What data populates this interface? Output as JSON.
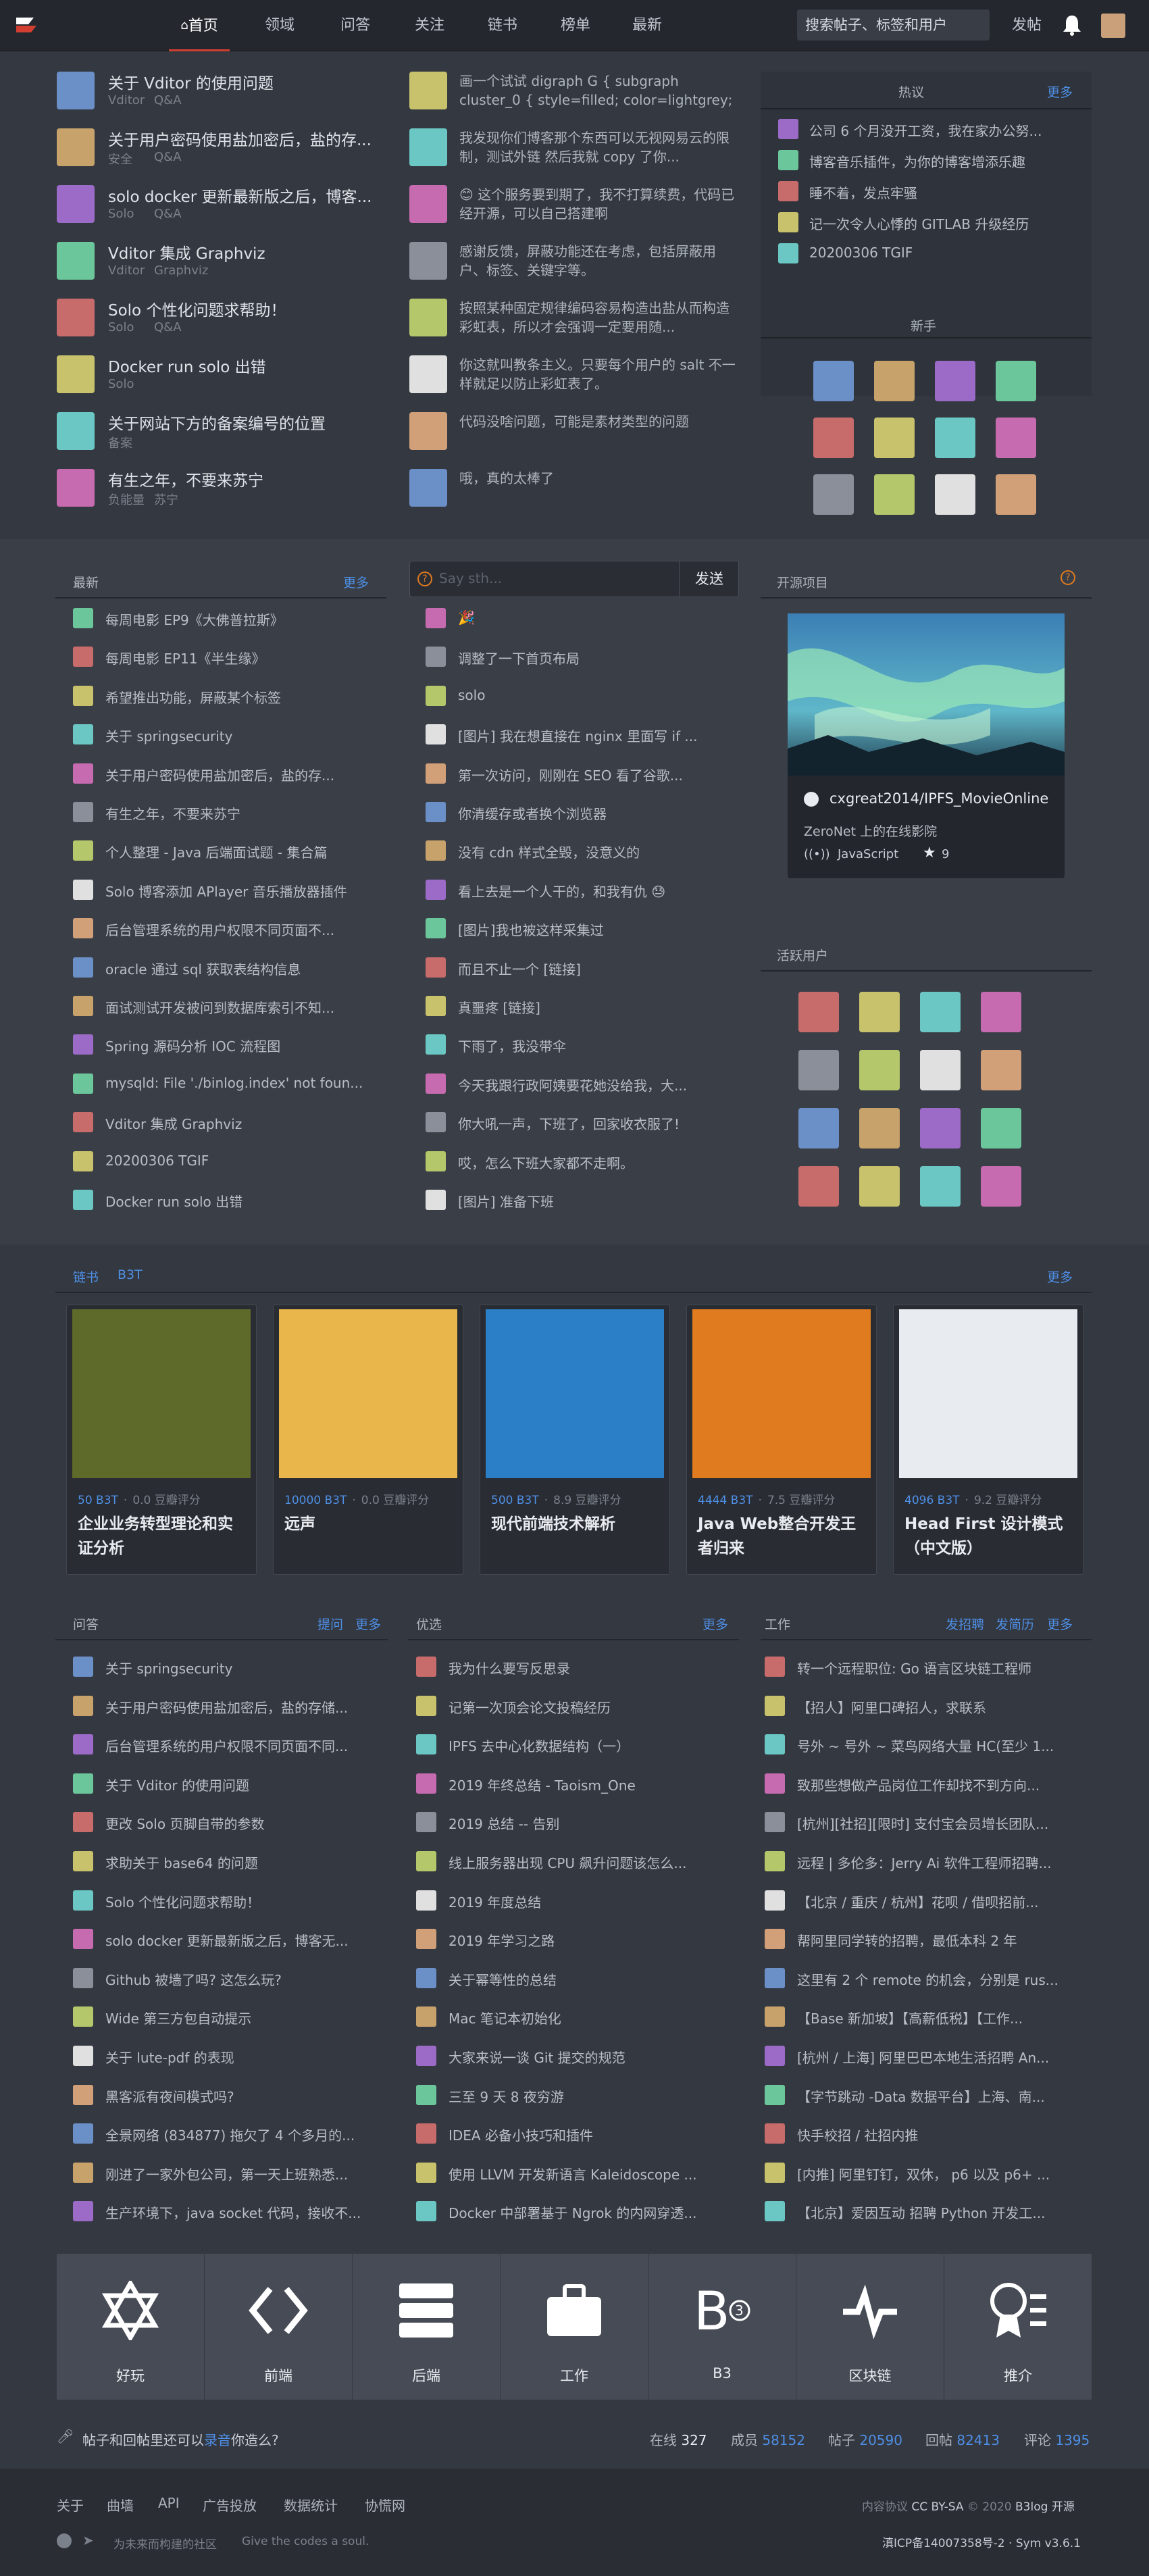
{
  "colors": {
    "accent": "#d23f31",
    "link": "#4e8fe5",
    "bg": "#343841",
    "nav_bg": "#24272e"
  },
  "nav": {
    "items": [
      "首页",
      "领域",
      "问答",
      "关注",
      "链书",
      "榜单",
      "最新"
    ],
    "search_placeholder": "搜索帖子、标签和用户",
    "post": "发帖"
  },
  "top": {
    "left": [
      {
        "title": "关于 Vditor 的使用问题",
        "tags": [
          "Vditor",
          "Q&A"
        ]
      },
      {
        "title": "关于用户密码使用盐加密后，盐的存...",
        "tags": [
          "安全",
          "Q&A"
        ]
      },
      {
        "title": "solo docker 更新最新版之后，博客...",
        "tags": [
          "Solo",
          "Q&A"
        ]
      },
      {
        "title": "Vditor 集成 Graphviz",
        "tags": [
          "Vditor",
          "Graphviz"
        ]
      },
      {
        "title": "Solo 个性化问题求帮助！",
        "tags": [
          "Solo",
          "Q&A"
        ]
      },
      {
        "title": "Docker run solo 出错",
        "tags": [
          "Solo"
        ]
      },
      {
        "title": "关于网站下方的备案编号的位置",
        "tags": [
          "备案"
        ]
      },
      {
        "title": "有生之年，不要来苏宁",
        "tags": [
          "负能量",
          "苏宁"
        ]
      }
    ],
    "mid": [
      "画一个试试 digraph G { subgraph cluster_0 { style=filled; color=lightgrey; node [...",
      "我发现你们博客那个东西可以无视网易云的限制，测试外链 然后我就 copy 了你...",
      "😊 这个服务要到期了，我不打算续费，代码已经开源，可以自己搭建啊",
      "感谢反馈，屏蔽功能还在考虑，包括屏蔽用户、标签、关键字等。",
      "按照某种固定规律编码容易构造出盐从而构造彩虹表，所以才会强调一定要用随...",
      "你这就叫教条主义。只要每个用户的 salt 不一样就足以防止彩虹表了。",
      "代码没啥问题，可能是素材类型的问题",
      "哦，真的太棒了"
    ],
    "hot": {
      "title": "热议",
      "more": "更多",
      "items": [
        "公司 6 个月没开工资，我在家办公努...",
        "博客音乐插件，为你的博客增添乐趣",
        "睡不着，发点牢骚",
        "记一次令人心悸的 GITLAB 升级经历",
        "20200306 TGIF"
      ]
    },
    "newbie": {
      "title": "新手"
    }
  },
  "latest": {
    "title": "最新",
    "more": "更多",
    "items": [
      "每周电影 EP9《大佛普拉斯》",
      "每周电影 EP11《半生缘》",
      "希望推出功能，屏蔽某个标签",
      "关于 springsecurity",
      "关于用户密码使用盐加密后，盐的存...",
      "有生之年，不要来苏宁",
      "个人整理 - Java 后端面试题 - 集合篇",
      "Solo 博客添加 APlayer 音乐播放器插件",
      "后台管理系统的用户权限不同页面不...",
      "oracle 通过 sql 获取表结构信息",
      "面试测试开发被问到数据库索引不知...",
      "Spring 源码分析 IOC 流程图",
      "mysqld: File './binlog.index' not foun...",
      "Vditor 集成 Graphviz",
      "20200306 TGIF",
      "Docker run solo 出错"
    ]
  },
  "chat": {
    "placeholder": "Say sth...",
    "send": "发送",
    "items": [
      "🎉",
      "调整了一下首页布局",
      "solo",
      "[图片] 我在想直接在 nginx 里面写 if ...",
      "第一次访问，刚刚在 SEO 看了谷歌...",
      "你清缓存或者换个浏览器",
      "没有 cdn 样式全毁，没意义的",
      "看上去是一个人干的，和我有仇 😓",
      "[图片]我也被这样采集过",
      "而且不止一个 [链接]",
      "真噩疼 [链接]",
      "下雨了，我没带伞",
      "今天我跟行政阿姨要花她没给我，大...",
      "你大吼一声，下班了，回家收衣服了!",
      "哎，怎么下班大家都不走啊。",
      "[图片] 准备下班"
    ]
  },
  "project": {
    "title": "开源项目",
    "repo": "cxgreat2014/IPFS_MovieOnline",
    "desc": "ZeroNet 上的在线影院",
    "lang": "JavaScript",
    "stars": "9"
  },
  "active": {
    "title": "活跃用户"
  },
  "books": {
    "tabs": [
      "链书",
      "B3T"
    ],
    "more": "更多",
    "items": [
      {
        "b3t": "50 B3T",
        "score": "0.0 豆瓣评分",
        "title": "企业业务转型理论和实证分析"
      },
      {
        "b3t": "10000 B3T",
        "score": "0.0 豆瓣评分",
        "title": "远声"
      },
      {
        "b3t": "500 B3T",
        "score": "8.9 豆瓣评分",
        "title": "现代前端技术解析"
      },
      {
        "b3t": "4444 B3T",
        "score": "7.5 豆瓣评分",
        "title": "Java Web整合开发王者归来"
      },
      {
        "b3t": "4096 B3T",
        "score": "9.2 豆瓣评分",
        "title": "Head First 设计模式（中文版）"
      }
    ]
  },
  "qa": {
    "title": "问答",
    "ask": "提问",
    "more": "更多",
    "items": [
      "关于 springsecurity",
      "关于用户密码使用盐加密后，盐的存储...",
      "后台管理系统的用户权限不同页面不同...",
      "关于 Vditor 的使用问题",
      "更改 Solo 页脚自带的参数",
      "求助关于 base64 的问题",
      "Solo 个性化问题求帮助！",
      "solo docker 更新最新版之后，博客无...",
      "Github 被墙了吗? 这怎么玩?",
      "Wide 第三方包自动提示",
      "关于 lute-pdf 的表现",
      "黑客派有夜间模式吗?",
      "全景网络 (834877) 拖欠了 4 个多月的...",
      "刚进了一家外包公司，第一天上班熟悉...",
      "生产环境下，java socket 代码，接收不..."
    ]
  },
  "good": {
    "title": "优选",
    "more": "更多",
    "items": [
      "我为什么要写反思录",
      "记第一次顶会论文投稿经历",
      "IPFS 去中心化数据结构（一）",
      "2019 年终总结 - Taoism_One",
      "2019 总结 -- 告别",
      "线上服务器出现 CPU 飙升问题该怎么...",
      "2019 年度总结",
      "2019 年学习之路",
      "关于幂等性的总结",
      "Mac 笔记本初始化",
      "大家来说一谈 Git 提交的规范",
      "三至 9 天 8 夜穷游",
      "IDEA 必备小技巧和插件",
      "使用 LLVM 开发新语言 Kaleidoscope ...",
      "Docker 中部署基于 Ngrok 的内网穿透..."
    ]
  },
  "jobs": {
    "title": "工作",
    "post": "发招聘",
    "resume": "发简历",
    "more": "更多",
    "items": [
      "转一个远程职位: Go 语言区块链工程师",
      "【招人】阿里口碑招人，求联系",
      "号外 ~ 号外 ~ 菜鸟网络大量 HC(至少 1...",
      "致那些想做产品岗位工作却找不到方向...",
      "[杭州][社招][限时] 支付宝会员增长团队...",
      "远程 | 多伦多：Jerry Ai 软件工程师招聘...",
      "【北京 / 重庆 / 杭州】花呗 / 借呗招前...",
      "帮阿里同学转的招聘，最低本科 2 年",
      "这里有 2 个 remote 的机会，分别是 rus...",
      "【Base 新加坡】【高薪低税】【工作...",
      "[杭州 / 上海] 阿里巴巴本地生活招聘 An...",
      "【字节跳动 -Data 数据平台】上海、南...",
      "快手校招 / 社招内推",
      "[内推] 阿里钉钉，双休， p6 以及 p6+ ...",
      "【北京】爱因互动 招聘 Python 开发工..."
    ]
  },
  "tiles": [
    "好玩",
    "前端",
    "后端",
    "工作",
    "B3",
    "区块链",
    "推介"
  ],
  "stats": {
    "prompt": "帖子和回帖里还可以",
    "audio": "录音",
    "prompt_end": "你造么?",
    "online_label": "在线",
    "online": "327",
    "members_label": "成员",
    "members": "58152",
    "posts_label": "帖子",
    "posts": "20590",
    "replies_label": "回帖",
    "replies": "82413",
    "comments_label": "评论",
    "comments": "1395"
  },
  "footer": {
    "links": [
      "关于",
      "曲墙",
      "API",
      "广告投放",
      "数据统计",
      "协慌网"
    ],
    "slogan": "为未来而构建的社区",
    "slogan_en": "Give the codes a soul.",
    "license_label": "内容协议",
    "license": "CC BY-SA",
    "copyright": "© 2020",
    "brand": "B3log 开源",
    "icp": "滇ICP备14007358号-2",
    "version": "Sym v3.6.1"
  }
}
